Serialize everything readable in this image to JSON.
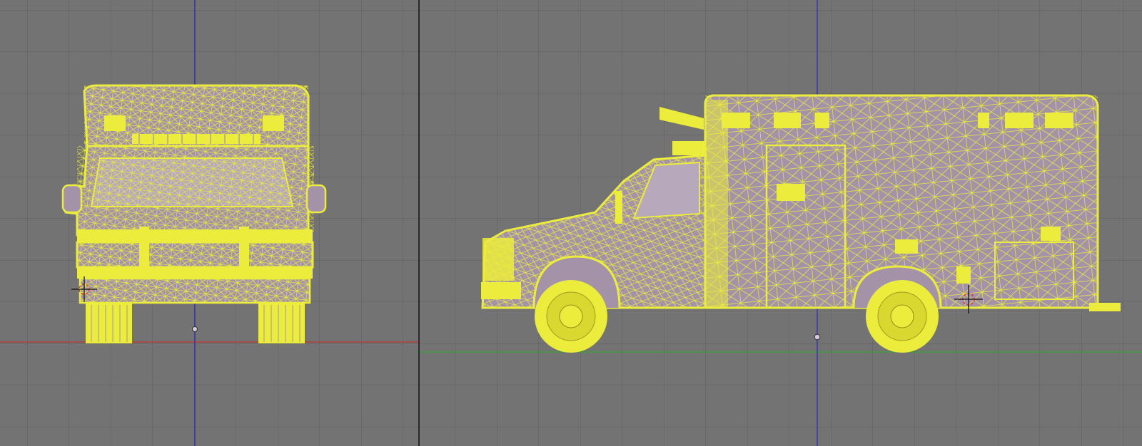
{
  "app": {
    "title": ""
  },
  "colors": {
    "background": "#737373",
    "grid_line": "#5f5f5f",
    "x_axis": "#c03535",
    "y_axis": "#3aa03a",
    "z_axis": "#2a2ab8",
    "wire": "#ecec3c",
    "face": "#a493a8",
    "face_light": "#b7a8bb",
    "cursor_red": "#d83030",
    "cursor_black": "#111111"
  },
  "viewports": [
    {
      "id": "front",
      "view": "front-orthographic",
      "horizontal_axis": "x",
      "vertical_axis": "z"
    },
    {
      "id": "side",
      "view": "side-orthographic",
      "horizontal_axis": "y",
      "vertical_axis": "z"
    }
  ],
  "model": {
    "object": "ambulance",
    "display": "wireframe-selected"
  },
  "icons": [
    "3d-cursor-icon",
    "object-origin-icon"
  ]
}
